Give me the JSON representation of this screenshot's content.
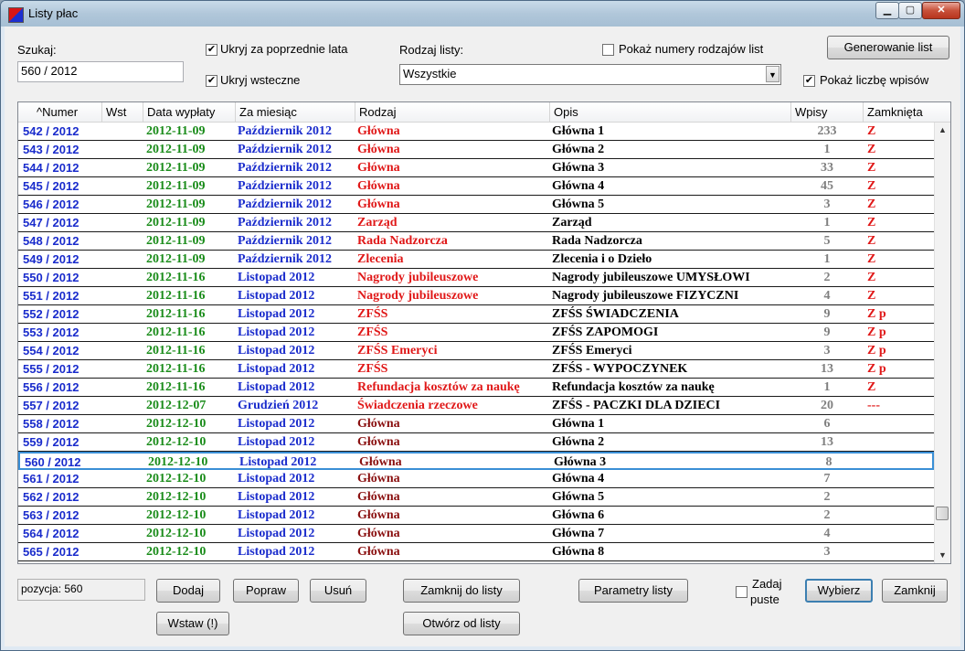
{
  "window": {
    "title": "Listy płac",
    "min_icon": "minimize-icon",
    "max_icon": "maximize-icon",
    "close_icon": "close-icon",
    "min_glyph": "▁",
    "max_glyph": "▢",
    "close_glyph": "✕"
  },
  "filters": {
    "search_label": "Szukaj:",
    "search_value": "560 / 2012",
    "hide_prev_years": {
      "label": "Ukryj za poprzednie lata",
      "checked": true
    },
    "hide_retro": {
      "label": "Ukryj wsteczne",
      "checked": true
    },
    "kind_label": "Rodzaj listy:",
    "kind_value": "Wszystkie",
    "show_kind_numbers": {
      "label": "Pokaż numery rodzajów list",
      "checked": false
    },
    "show_entry_count": {
      "label": "Pokaż liczbę wpisów",
      "checked": true
    },
    "generate_button": "Generowanie list",
    "check_glyph": "✔"
  },
  "table": {
    "headers": [
      "^Numer",
      "Wst",
      "Data wypłaty",
      "Za miesiąc",
      "Rodzaj",
      "Opis",
      "Wpisy",
      "Zamknięta"
    ],
    "rows": [
      {
        "num": "542 / 2012",
        "wst": "",
        "date": "2012-11-09",
        "month": "Październik 2012",
        "kind": "Główna",
        "desc": "Główna 1",
        "count": "233",
        "closed": "Z"
      },
      {
        "num": "543 / 2012",
        "wst": "",
        "date": "2012-11-09",
        "month": "Październik 2012",
        "kind": "Główna",
        "desc": "Główna 2",
        "count": "1",
        "closed": "Z"
      },
      {
        "num": "544 / 2012",
        "wst": "",
        "date": "2012-11-09",
        "month": "Październik 2012",
        "kind": "Główna",
        "desc": "Główna 3",
        "count": "33",
        "closed": "Z"
      },
      {
        "num": "545 / 2012",
        "wst": "",
        "date": "2012-11-09",
        "month": "Październik 2012",
        "kind": "Główna",
        "desc": "Główna 4",
        "count": "45",
        "closed": "Z"
      },
      {
        "num": "546 / 2012",
        "wst": "",
        "date": "2012-11-09",
        "month": "Październik 2012",
        "kind": "Główna",
        "desc": "Główna 5",
        "count": "3",
        "closed": "Z"
      },
      {
        "num": "547 / 2012",
        "wst": "",
        "date": "2012-11-09",
        "month": "Październik 2012",
        "kind": "Zarząd",
        "desc": "Zarząd",
        "count": "1",
        "closed": "Z"
      },
      {
        "num": "548 / 2012",
        "wst": "",
        "date": "2012-11-09",
        "month": "Październik 2012",
        "kind": "Rada Nadzorcza",
        "desc": "Rada Nadzorcza",
        "count": "5",
        "closed": "Z"
      },
      {
        "num": "549 / 2012",
        "wst": "",
        "date": "2012-11-09",
        "month": "Październik 2012",
        "kind": "Zlecenia",
        "desc": "Zlecenia i o Dzieło",
        "count": "1",
        "closed": "Z"
      },
      {
        "num": "550 / 2012",
        "wst": "",
        "date": "2012-11-16",
        "month": "Listopad 2012",
        "kind": "Nagrody jubileuszowe",
        "desc": "Nagrody jubileuszowe UMYSŁOWI",
        "count": "2",
        "closed": "Z"
      },
      {
        "num": "551 / 2012",
        "wst": "",
        "date": "2012-11-16",
        "month": "Listopad 2012",
        "kind": "Nagrody jubileuszowe",
        "desc": "Nagrody jubileuszowe FIZYCZNI",
        "count": "4",
        "closed": "Z"
      },
      {
        "num": "552 / 2012",
        "wst": "",
        "date": "2012-11-16",
        "month": "Listopad 2012",
        "kind": "ZFŚS",
        "desc": "ZFŚS ŚWIADCZENIA",
        "count": "9",
        "closed": "Z p"
      },
      {
        "num": "553 / 2012",
        "wst": "",
        "date": "2012-11-16",
        "month": "Listopad 2012",
        "kind": "ZFŚS",
        "desc": "ZFŚS ZAPOMOGI",
        "count": "9",
        "closed": "Z p"
      },
      {
        "num": "554 / 2012",
        "wst": "",
        "date": "2012-11-16",
        "month": "Listopad 2012",
        "kind": "ZFŚS Emeryci",
        "desc": "ZFŚS Emeryci",
        "count": "3",
        "closed": "Z p"
      },
      {
        "num": "555 / 2012",
        "wst": "",
        "date": "2012-11-16",
        "month": "Listopad 2012",
        "kind": "ZFŚS",
        "desc": "ZFŚS - WYPOCZYNEK",
        "count": "13",
        "closed": "Z p"
      },
      {
        "num": "556 / 2012",
        "wst": "",
        "date": "2012-11-16",
        "month": "Listopad 2012",
        "kind": "Refundacja kosztów za naukę",
        "desc": "Refundacja kosztów za naukę",
        "count": "1",
        "closed": "Z"
      },
      {
        "num": "557 / 2012",
        "wst": "",
        "date": "2012-12-07",
        "month": "Grudzień 2012",
        "kind": "Świadczenia rzeczowe",
        "desc": "ZFŚS - PACZKI DLA DZIECI",
        "count": "20",
        "closed": "---"
      },
      {
        "num": "558 / 2012",
        "wst": "",
        "date": "2012-12-10",
        "month": "Listopad 2012",
        "kind": "Główna",
        "desc": "Główna 1",
        "count": "6",
        "closed": ""
      },
      {
        "num": "559 / 2012",
        "wst": "",
        "date": "2012-12-10",
        "month": "Listopad 2012",
        "kind": "Główna",
        "desc": "Główna 2",
        "count": "13",
        "closed": ""
      },
      {
        "num": "560 / 2012",
        "wst": "",
        "date": "2012-12-10",
        "month": "Listopad 2012",
        "kind": "Główna",
        "desc": "Główna 3",
        "count": "8",
        "closed": "",
        "selected": true
      },
      {
        "num": "561 / 2012",
        "wst": "",
        "date": "2012-12-10",
        "month": "Listopad 2012",
        "kind": "Główna",
        "desc": "Główna 4",
        "count": "7",
        "closed": ""
      },
      {
        "num": "562 / 2012",
        "wst": "",
        "date": "2012-12-10",
        "month": "Listopad 2012",
        "kind": "Główna",
        "desc": "Główna 5",
        "count": "2",
        "closed": ""
      },
      {
        "num": "563 / 2012",
        "wst": "",
        "date": "2012-12-10",
        "month": "Listopad 2012",
        "kind": "Główna",
        "desc": "Główna 6",
        "count": "2",
        "closed": ""
      },
      {
        "num": "564 / 2012",
        "wst": "",
        "date": "2012-12-10",
        "month": "Listopad 2012",
        "kind": "Główna",
        "desc": "Główna 7",
        "count": "4",
        "closed": ""
      },
      {
        "num": "565 / 2012",
        "wst": "",
        "date": "2012-12-10",
        "month": "Listopad 2012",
        "kind": "Główna",
        "desc": "Główna 8",
        "count": "3",
        "closed": ""
      }
    ],
    "scroll_up_glyph": "▲",
    "scroll_down_glyph": "▼"
  },
  "footer": {
    "position_label": "pozycja:  560",
    "add": "Dodaj",
    "edit": "Popraw",
    "delete": "Usuń",
    "insert": "Wstaw (!)",
    "close_to_list": "Zamknij do listy",
    "open_from_list": "Otwórz od listy",
    "list_params": "Parametry listy",
    "ask_empty_line1": "Zadaj",
    "ask_empty_line2": "puste",
    "ask_empty_checked": false,
    "choose": "Wybierz",
    "close": "Zamknij"
  },
  "colors": {
    "number": "#1a2ccc",
    "date": "#1a8c1a",
    "month": "#1a2ccc",
    "kind": "#e01818",
    "kind_dark": "#8a1010",
    "count": "#808080",
    "closed": "#e01818",
    "selection": "#3a8fd6"
  }
}
